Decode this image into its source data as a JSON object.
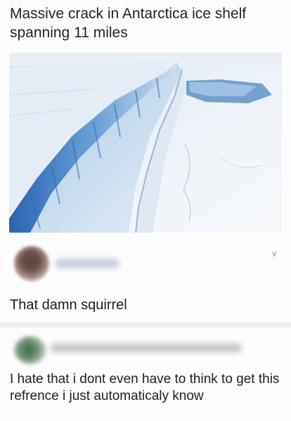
{
  "post": {
    "title": "Massive crack in Antarctica ice shelf spanning 11 miles"
  },
  "photo": {
    "subject": "Antarctic ice shelf crack"
  },
  "comments": [
    {
      "author_name": "",
      "text": "That damn squirrel",
      "menu_icon": "chevron-down-icon"
    },
    {
      "author_name": "",
      "text": "I hate that i dont even have to think to get this refrence i just automaticaly know"
    }
  ],
  "colors": {
    "background": "#fdfdfd",
    "divider": "#ececec",
    "ice_blue": "#4a86c8"
  }
}
